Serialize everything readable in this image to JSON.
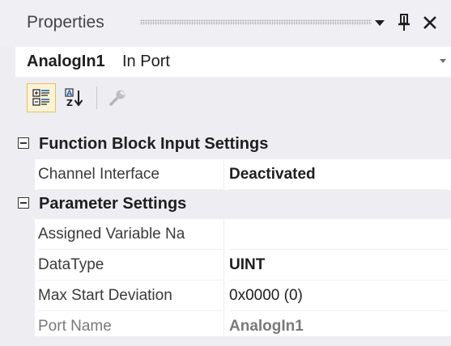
{
  "panel": {
    "title": "Properties"
  },
  "selector": {
    "object_name": "AnalogIn1",
    "object_type": "In Port"
  },
  "toolbar": {
    "icons": [
      "categorized-icon",
      "alphabetical-icon",
      "property-pages-icon"
    ]
  },
  "grid": {
    "categories": [
      {
        "label": "Function Block Input Settings",
        "expanded": true,
        "properties": [
          {
            "name": "Channel Interface",
            "value": "Deactivated"
          }
        ]
      },
      {
        "label": "Parameter Settings",
        "expanded": true,
        "properties": [
          {
            "name": "Assigned Variable Na",
            "value": ""
          },
          {
            "name": "DataType",
            "value": "UINT"
          },
          {
            "name": "Max Start Deviation",
            "value": "0x0000 (0)"
          },
          {
            "name": "Port Name",
            "value": "AnalogIn1"
          }
        ]
      }
    ]
  },
  "colors": {
    "background": "#eeeef2",
    "selected_tool_fill": "#fbf3d6",
    "selected_tool_border": "#e6c160",
    "readonly_text": "#7a7a7a"
  }
}
